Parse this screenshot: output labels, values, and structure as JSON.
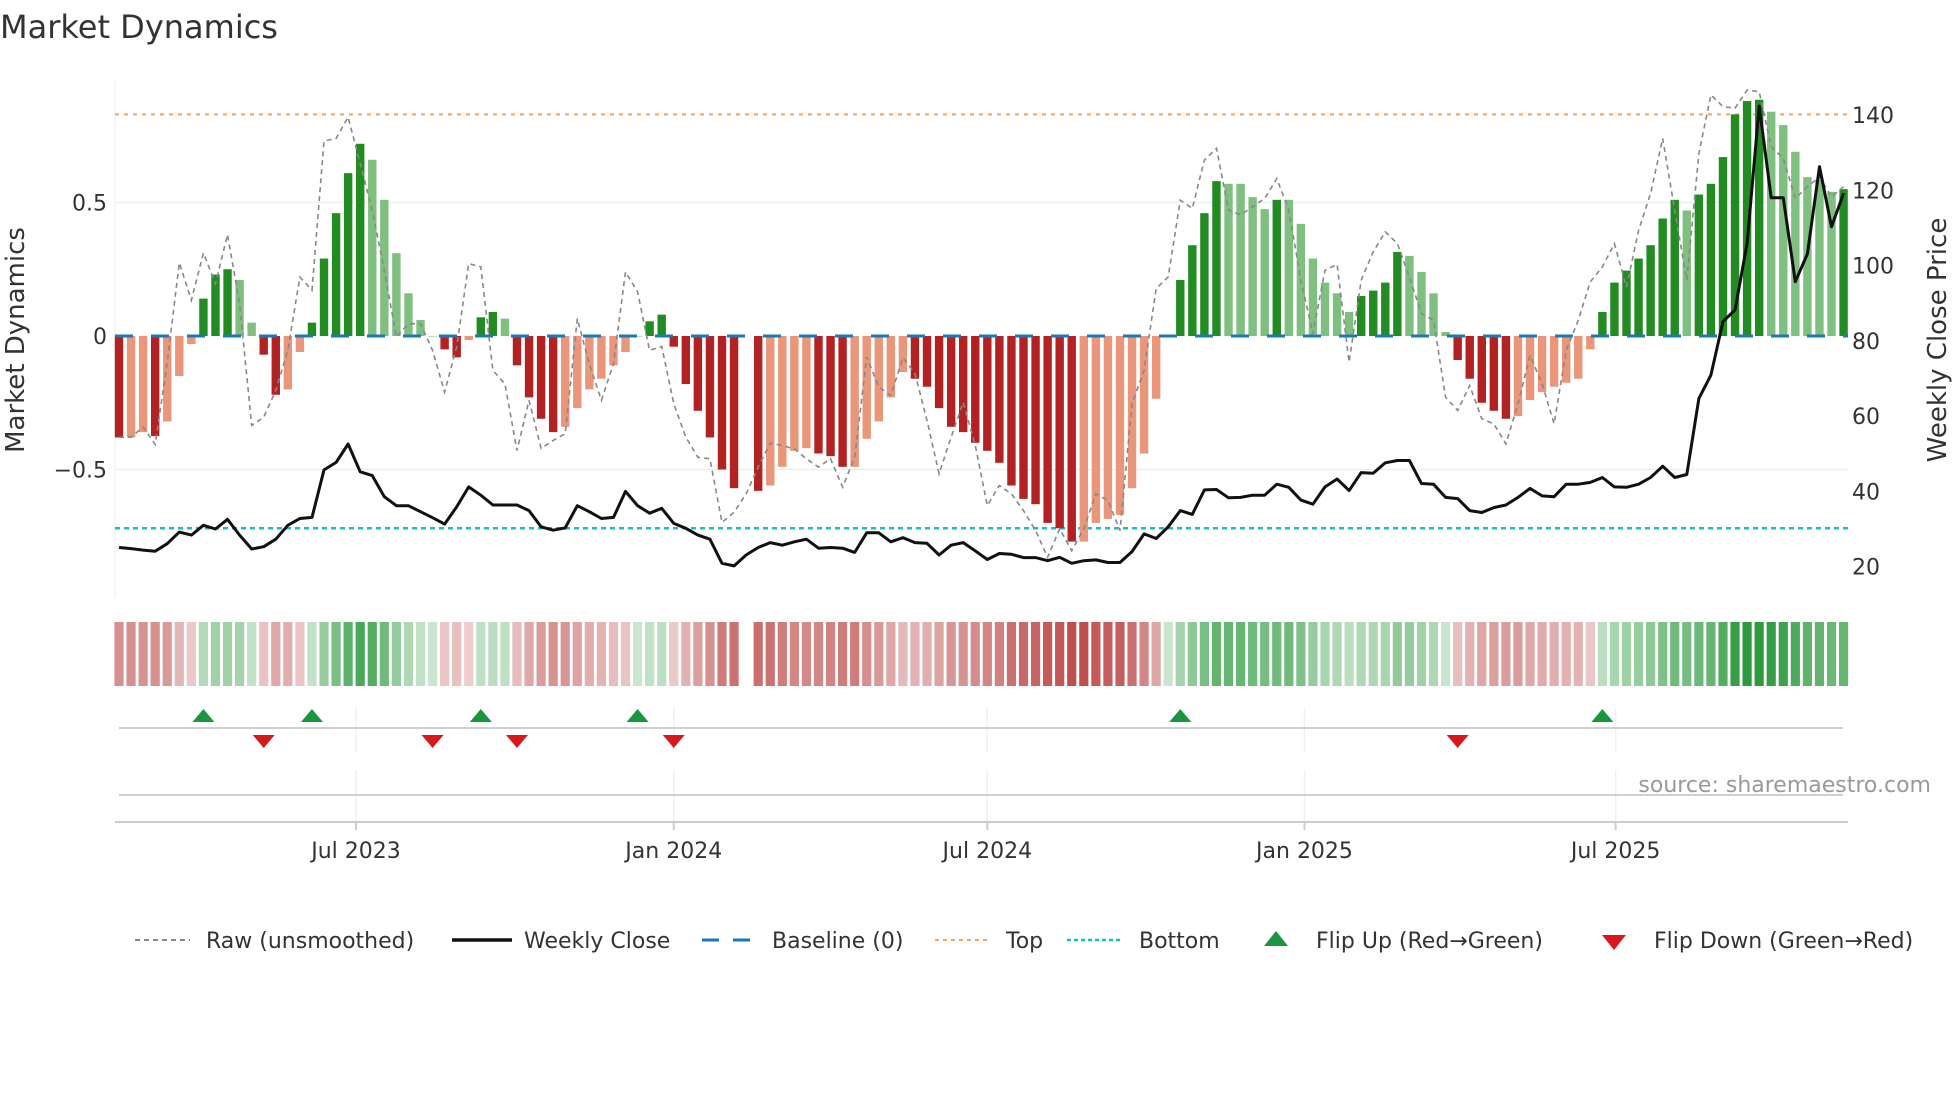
{
  "chart_data": {
    "type": "bar",
    "title": "Market Dynamics",
    "ylabel": "Market Dynamics",
    "y2label": "Weekly Close Price",
    "ylim": [
      -0.97,
      1.0
    ],
    "y2lim": [
      14,
      152
    ],
    "yticks": [
      {
        "v": 0.5,
        "label": "0.5"
      },
      {
        "v": 0,
        "label": "0"
      },
      {
        "v": -0.5,
        "label": "−0.5"
      }
    ],
    "y2ticks": [
      {
        "v": 140,
        "label": "140"
      },
      {
        "v": 120,
        "label": "120"
      },
      {
        "v": 100,
        "label": "100"
      },
      {
        "v": 80,
        "label": "80"
      },
      {
        "v": 60,
        "label": "60"
      },
      {
        "v": 40,
        "label": "40"
      },
      {
        "v": 20,
        "label": "20"
      }
    ],
    "xticks": [
      {
        "week": 19.65,
        "label": "Jul 2023"
      },
      {
        "week": 46.0,
        "label": "Jan 2024"
      },
      {
        "week": 72.0,
        "label": "Jul 2024"
      },
      {
        "week": 98.3,
        "label": "Jan 2025"
      },
      {
        "week": 124.1,
        "label": "Jul 2025"
      }
    ],
    "top_level": 0.83,
    "bottom_level": -0.72,
    "baseline": 0,
    "momentum": [
      -0.38,
      -0.38,
      -0.36,
      -0.375,
      -0.32,
      -0.15,
      -0.03,
      0.14,
      0.23,
      0.25,
      0.21,
      0.05,
      -0.07,
      -0.22,
      -0.2,
      -0.06,
      0.05,
      0.29,
      0.46,
      0.61,
      0.72,
      0.66,
      0.51,
      0.31,
      0.16,
      0.06,
      0,
      -0.05,
      -0.08,
      -0.015,
      0.07,
      0.09,
      0.065,
      -0.11,
      -0.23,
      -0.31,
      -0.36,
      -0.34,
      -0.27,
      -0.2,
      -0.16,
      -0.11,
      -0.06,
      0,
      0.055,
      0.08,
      -0.04,
      -0.18,
      -0.28,
      -0.38,
      -0.5,
      -0.57,
      null,
      -0.58,
      -0.56,
      -0.49,
      -0.43,
      -0.42,
      -0.44,
      -0.45,
      -0.49,
      -0.49,
      -0.385,
      -0.32,
      -0.23,
      -0.135,
      -0.16,
      -0.19,
      -0.27,
      -0.34,
      -0.36,
      -0.4,
      -0.43,
      -0.475,
      -0.56,
      -0.61,
      -0.63,
      -0.7,
      -0.72,
      -0.77,
      -0.77,
      -0.7,
      -0.685,
      -0.67,
      -0.57,
      -0.44,
      -0.235,
      0,
      0.21,
      0.34,
      0.46,
      0.58,
      0.57,
      0.57,
      0.52,
      0.475,
      0.51,
      0.51,
      0.42,
      0.29,
      0.2,
      0.16,
      0.09,
      0.15,
      0.17,
      0.2,
      0.315,
      0.3,
      0.24,
      0.16,
      0.015,
      -0.09,
      -0.16,
      -0.25,
      -0.28,
      -0.31,
      -0.3,
      -0.24,
      -0.21,
      -0.19,
      -0.175,
      -0.16,
      -0.05,
      0.09,
      0.2,
      0.245,
      0.29,
      0.34,
      0.44,
      0.51,
      0.47,
      0.53,
      0.57,
      0.67,
      0.83,
      0.88,
      0.885,
      0.84,
      0.79,
      0.69,
      0.595,
      0.585,
      0.54,
      0.55
    ],
    "strengthening": [
      1,
      0,
      0,
      1,
      0,
      0,
      0,
      1,
      1,
      1,
      0,
      0,
      1,
      1,
      0,
      0,
      1,
      1,
      1,
      1,
      1,
      0,
      0,
      0,
      0,
      0,
      0,
      1,
      1,
      0,
      1,
      1,
      0,
      1,
      1,
      1,
      1,
      0,
      0,
      0,
      0,
      0,
      0,
      0,
      1,
      1,
      1,
      1,
      1,
      1,
      1,
      1,
      0,
      1,
      0,
      0,
      0,
      0,
      1,
      1,
      1,
      0,
      0,
      0,
      0,
      0,
      1,
      1,
      1,
      1,
      1,
      1,
      1,
      1,
      1,
      1,
      1,
      1,
      1,
      1,
      0,
      0,
      0,
      0,
      0,
      0,
      0,
      0,
      1,
      1,
      1,
      1,
      0,
      0,
      0,
      0,
      1,
      0,
      0,
      0,
      0,
      0,
      0,
      1,
      1,
      1,
      1,
      0,
      0,
      0,
      0,
      1,
      1,
      1,
      1,
      1,
      0,
      0,
      0,
      0,
      0,
      0,
      0,
      1,
      1,
      1,
      1,
      1,
      1,
      1,
      0,
      1,
      1,
      1,
      1,
      1,
      1,
      0,
      0,
      0,
      0,
      0,
      0,
      1
    ],
    "raw": [
      -0.379,
      -0.379,
      -0.341,
      -0.406,
      -0.1,
      0.274,
      0.134,
      0.311,
      0.196,
      0.38,
      0.121,
      -0.335,
      -0.304,
      -0.204,
      -0.054,
      0.221,
      0.171,
      0.73,
      0.74,
      0.82,
      0.646,
      0.471,
      0.246,
      -0.004,
      0.046,
      0.046,
      -0.054,
      -0.21,
      -0.041,
      0.271,
      0.259,
      -0.129,
      -0.179,
      -0.429,
      -0.241,
      -0.421,
      -0.391,
      -0.366,
      0.065,
      -0.104,
      -0.241,
      -0.104,
      0.24,
      0.165,
      -0.054,
      -0.039,
      -0.254,
      -0.379,
      -0.454,
      -0.46,
      -0.698,
      -0.66,
      -0.591,
      -0.491,
      -0.401,
      -0.41,
      -0.423,
      -0.46,
      -0.491,
      -0.46,
      -0.566,
      -0.454,
      -0.079,
      -0.191,
      -0.223,
      -0.081,
      -0.141,
      -0.316,
      -0.516,
      -0.379,
      -0.248,
      -0.41,
      -0.635,
      -0.56,
      -0.591,
      -0.654,
      -0.729,
      -0.829,
      -0.722,
      -0.804,
      -0.722,
      -0.591,
      -0.616,
      -0.729,
      -0.254,
      -0.129,
      0.178,
      0.221,
      0.509,
      0.478,
      0.659,
      0.703,
      0.471,
      0.453,
      0.484,
      0.515,
      0.59,
      0.471,
      0.209,
      0.009,
      0.246,
      0.268,
      -0.098,
      0.209,
      0.315,
      0.39,
      0.346,
      0.221,
      0.084,
      0.059,
      -0.229,
      -0.279,
      -0.185,
      -0.31,
      -0.329,
      -0.404,
      -0.254,
      -0.073,
      -0.179,
      -0.329,
      -0.054,
      0.059,
      0.203,
      0.259,
      0.346,
      0.184,
      0.396,
      0.534,
      0.74,
      0.471,
      0.209,
      0.684,
      0.903,
      0.859,
      0.853,
      0.921,
      0.915,
      0.709,
      0.665,
      0.515,
      0.559,
      0.596,
      0.521,
      0.559
    ],
    "weekly_close": [
      25.1,
      24.8,
      24.4,
      24.1,
      26.1,
      29.2,
      28.4,
      31.0,
      30.0,
      32.6,
      28.4,
      24.7,
      25.3,
      27.3,
      31.0,
      32.8,
      33.1,
      45.7,
      47.7,
      52.6,
      45.2,
      44.2,
      38.6,
      36.2,
      36.2,
      34.6,
      33.0,
      31.3,
      35.9,
      41.2,
      39.0,
      36.4,
      36.4,
      36.4,
      34.9,
      30.6,
      29.7,
      30.3,
      36.2,
      34.6,
      32.8,
      33.1,
      40.0,
      36.2,
      34.2,
      35.5,
      31.5,
      30.2,
      28.4,
      27.3,
      20.9,
      20.2,
      23.1,
      25.1,
      26.4,
      25.7,
      26.6,
      27.3,
      24.9,
      25.1,
      24.9,
      23.8,
      29.0,
      29.0,
      26.6,
      27.7,
      26.4,
      26.2,
      23.1,
      25.7,
      26.4,
      24.2,
      21.9,
      23.5,
      23.3,
      22.4,
      22.4,
      21.6,
      22.5,
      20.9,
      21.6,
      21.8,
      21.1,
      21.1,
      24.0,
      28.7,
      27.5,
      30.6,
      34.9,
      33.9,
      40.4,
      40.5,
      38.3,
      38.4,
      39.0,
      39.0,
      41.9,
      41.1,
      37.7,
      36.6,
      41.2,
      43.3,
      40.2,
      45.0,
      44.8,
      47.6,
      48.2,
      48.2,
      42.1,
      41.9,
      38.4,
      38.1,
      34.9,
      34.4,
      35.7,
      36.4,
      38.4,
      40.8,
      38.8,
      38.6,
      41.9,
      41.9,
      42.4,
      43.7,
      41.2,
      41.1,
      41.9,
      43.7,
      46.7,
      43.7,
      44.5,
      64.7,
      70.9,
      85.1,
      88.2,
      105.9,
      142.4,
      118.0,
      118.0,
      95.7,
      103.1,
      126.3,
      110.3,
      119.2
    ],
    "flip_up_weeks": [
      7,
      16,
      30,
      43,
      88,
      123
    ],
    "flip_down_weeks": [
      12,
      26,
      33,
      46,
      111
    ],
    "legend": {
      "position": "bottom",
      "items": [
        {
          "key": "raw",
          "label": "Raw (unsmoothed)"
        },
        {
          "key": "close",
          "label": "Weekly Close"
        },
        {
          "key": "baseline",
          "label": "Baseline (0)"
        },
        {
          "key": "top",
          "label": "Top"
        },
        {
          "key": "bottom",
          "label": "Bottom"
        },
        {
          "key": "flip_up",
          "label": "Flip Up (Red→Green)"
        },
        {
          "key": "flip_down",
          "label": "Flip Down (Green→Red)"
        }
      ]
    },
    "source": "source: sharemaestro.com",
    "colors": {
      "strong_up": "#228b22",
      "weak_up": "#7fbf7f",
      "strong_down": "#b22222",
      "weak_down": "#e9967a",
      "close": "#111111",
      "raw": "#888888",
      "baseline": "#1f77b4",
      "top": "#f4a460",
      "bottom": "#17becf",
      "flip_up": "#1a9641",
      "flip_down": "#d7191c"
    }
  }
}
